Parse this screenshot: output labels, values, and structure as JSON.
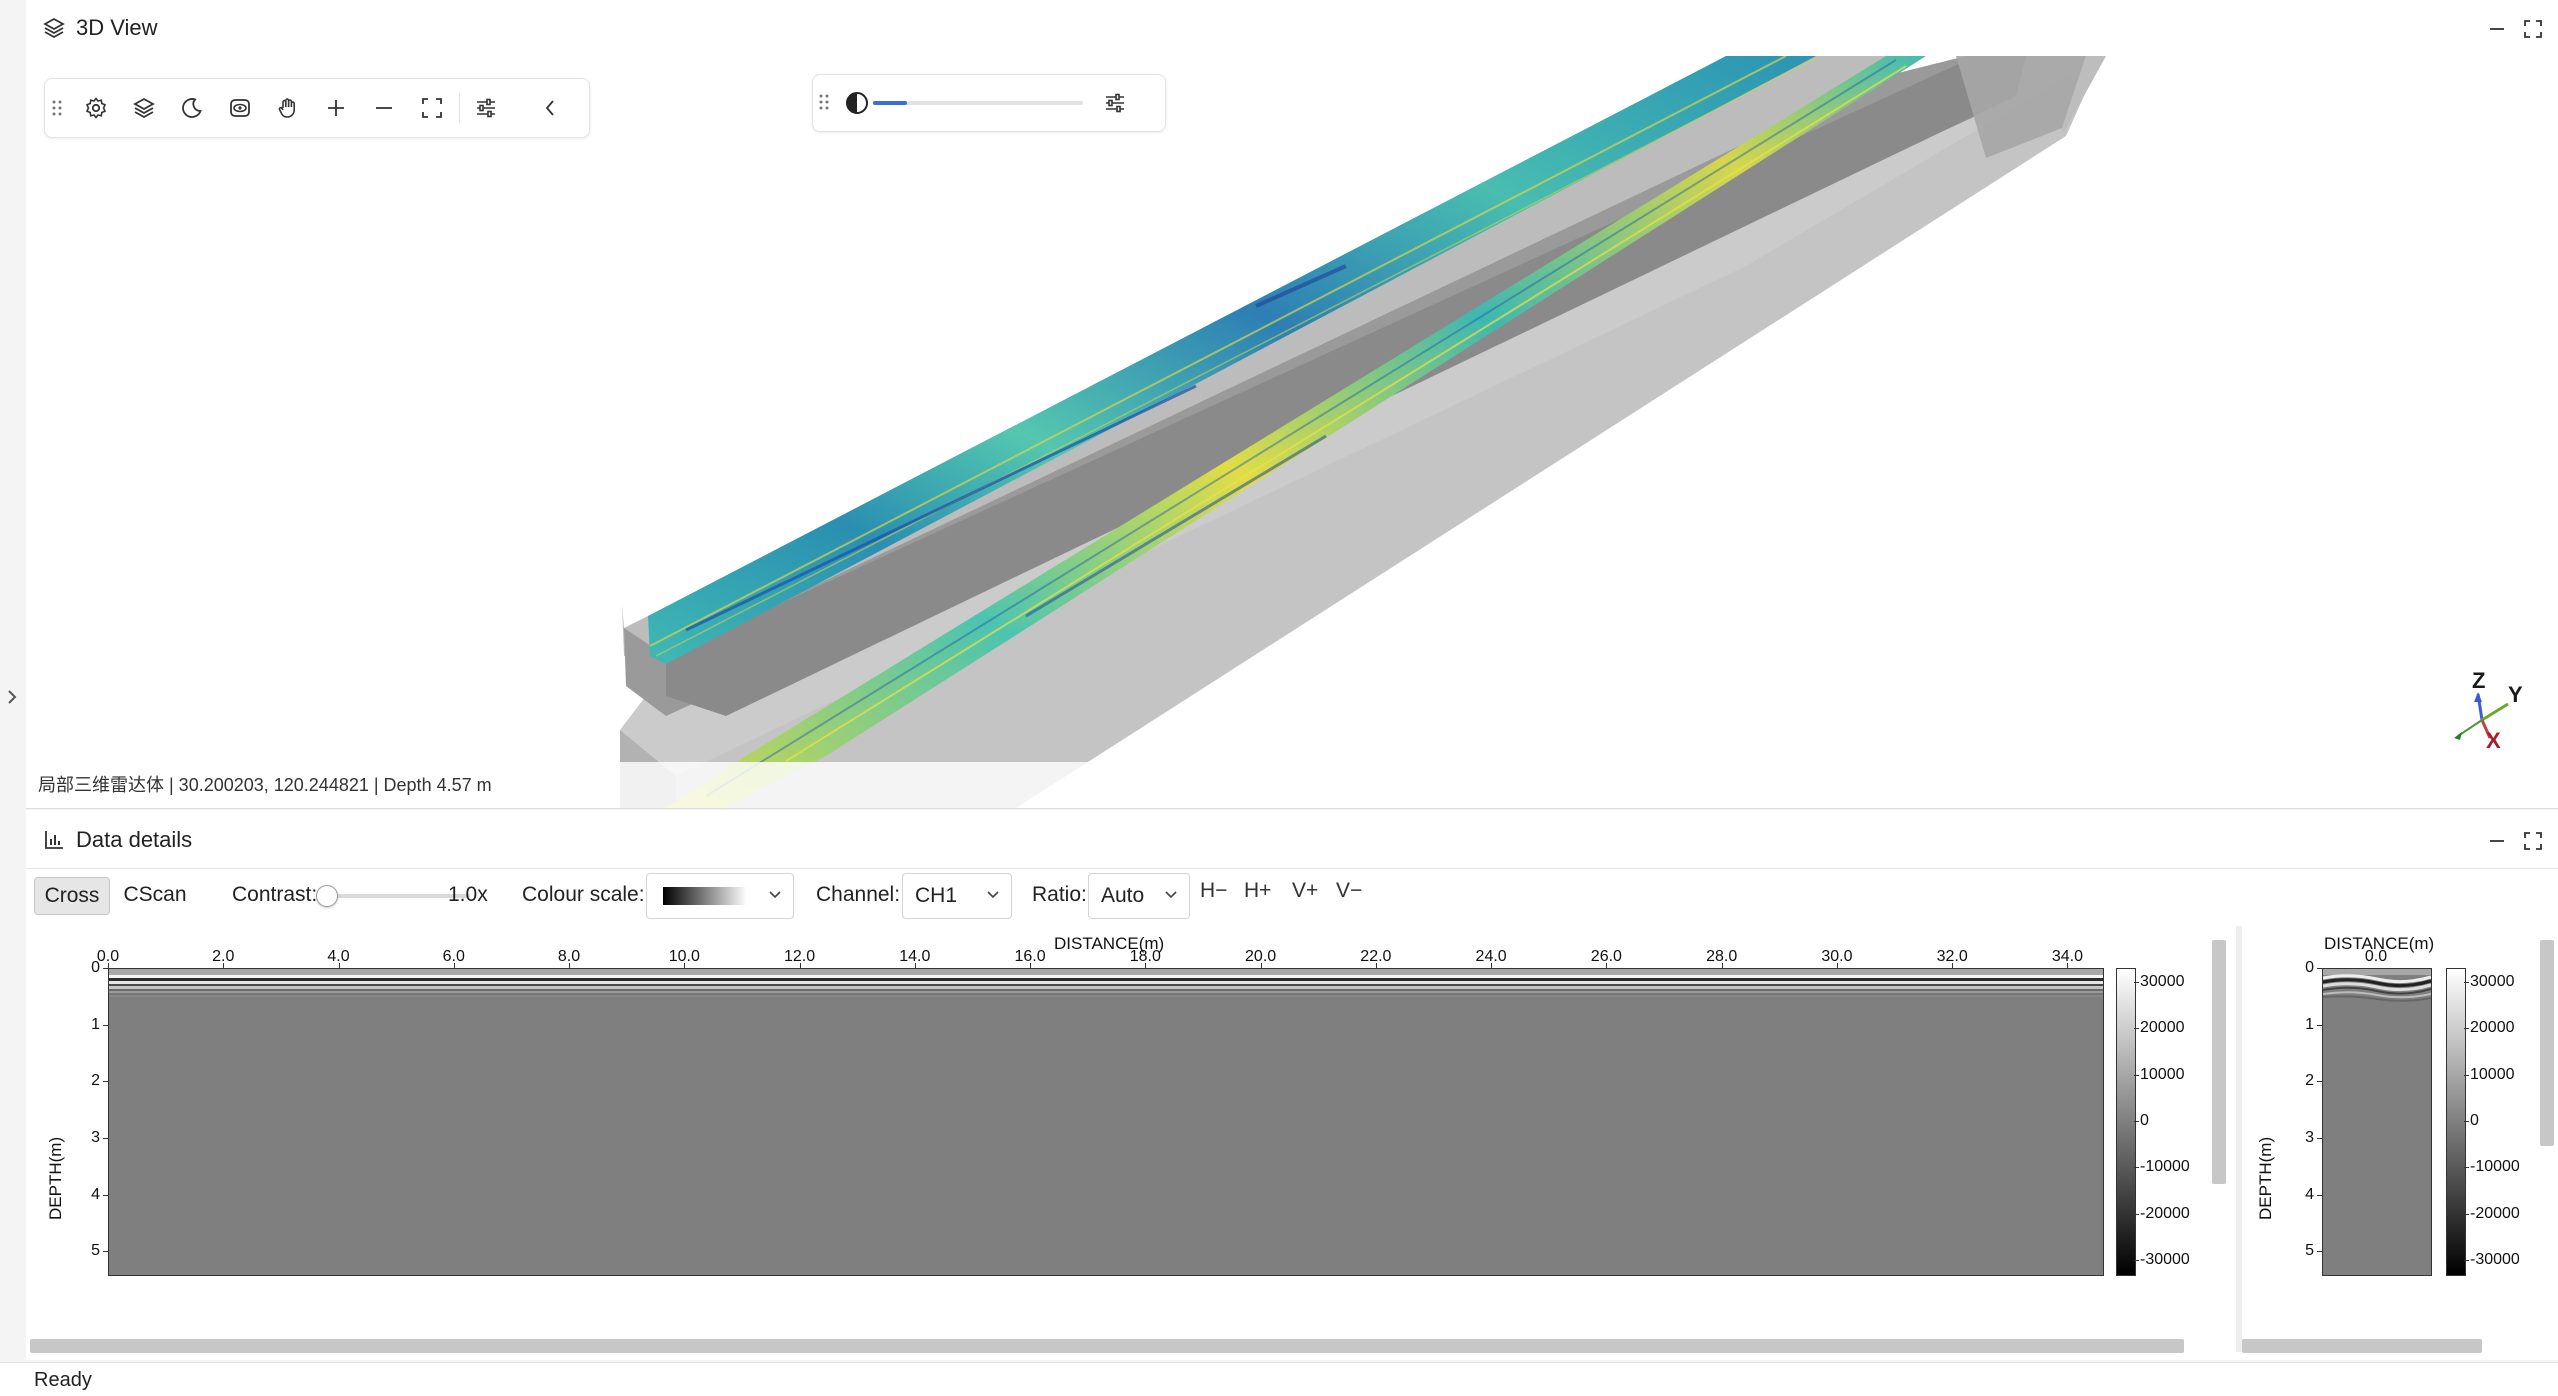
{
  "view3d": {
    "title": "3D View",
    "status_text": "局部三维雷达体 | 30.200203, 120.244821 | Depth 4.57 m",
    "toolbar_icons": [
      "drag-handle-icon",
      "settings-icon",
      "layers-icon",
      "dark-mode-icon",
      "view-icon",
      "pan-hand-icon",
      "zoom-in-icon",
      "zoom-out-icon",
      "fit-screen-icon",
      "adjust-icon",
      "collapse-icon"
    ],
    "slider": {
      "value_fraction": 0.16
    },
    "axes": {
      "z": "Z",
      "y": "Y",
      "x": "X"
    }
  },
  "details": {
    "title": "Data details",
    "tabs": {
      "cross": "Cross",
      "cscan": "CScan"
    },
    "contrast": {
      "label": "Contrast:",
      "value": "1.0x",
      "fraction": 0.04
    },
    "colour_scale": {
      "label": "Colour scale:"
    },
    "channel": {
      "label": "Channel:",
      "value": "CH1"
    },
    "ratio": {
      "label": "Ratio:",
      "value": "Auto"
    },
    "step_buttons": {
      "h_minus": "H−",
      "h_plus": "H+",
      "v_plus": "V+",
      "v_minus": "V−"
    }
  },
  "chart_data": [
    {
      "type": "heatmap",
      "title": "",
      "xlabel": "DISTANCE(m)",
      "ylabel": "DEPTH(m)",
      "x_ticks": [
        "0.0",
        "2.0",
        "4.0",
        "6.0",
        "8.0",
        "10.0",
        "12.0",
        "14.0",
        "16.0",
        "18.0",
        "20.0",
        "22.0",
        "24.0",
        "26.0",
        "28.0",
        "30.0",
        "32.0",
        "34.0"
      ],
      "y_ticks": [
        "0",
        "1",
        "2",
        "3",
        "4",
        "5"
      ],
      "xlim": [
        0,
        34.6
      ],
      "ylim": [
        0,
        5.4
      ],
      "colorbar": {
        "ticks": [
          "30000",
          "20000",
          "10000",
          "0",
          "-10000",
          "-20000",
          "-30000"
        ],
        "range": [
          -33000,
          33000
        ]
      }
    },
    {
      "type": "heatmap",
      "title": "",
      "xlabel": "DISTANCE(m)",
      "ylabel": "DEPTH(m)",
      "x_ticks": [
        "0.0"
      ],
      "y_ticks": [
        "0",
        "1",
        "2",
        "3",
        "4",
        "5"
      ],
      "ylim": [
        0,
        5.4
      ],
      "colorbar": {
        "ticks": [
          "30000",
          "20000",
          "10000",
          "0",
          "-10000",
          "-20000",
          "-30000"
        ],
        "range": [
          -33000,
          33000
        ]
      }
    }
  ],
  "status_bar": {
    "text": "Ready"
  }
}
